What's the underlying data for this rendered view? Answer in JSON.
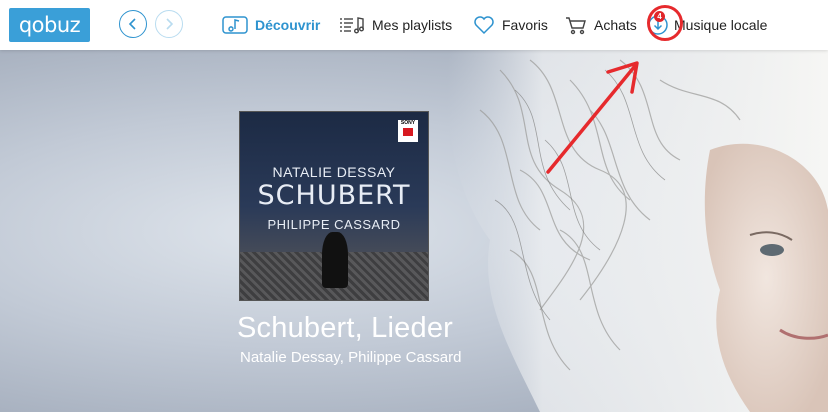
{
  "topbar": {
    "logo": "qobuz",
    "nav": {
      "back_icon": "chevron-left-icon",
      "forward_icon": "chevron-right-icon"
    },
    "menu": [
      {
        "label": "Découvrir",
        "icon": "music-note-icon",
        "active": true
      },
      {
        "label": "Mes playlists",
        "icon": "playlist-icon",
        "active": false
      },
      {
        "label": "Favoris",
        "icon": "heart-icon",
        "active": false
      },
      {
        "label": "Achats",
        "icon": "cart-icon",
        "active": false
      },
      {
        "label": "Musique locale",
        "icon": "download-icon",
        "active": false,
        "badge": "4"
      }
    ]
  },
  "hero": {
    "cover": {
      "label": "SONY",
      "artist_line1": "NATALIE DESSAY",
      "title": "SCHUBERT",
      "artist_line2": "PHILIPPE CASSARD"
    },
    "album_title": "Schubert, Lieder",
    "album_artist": "Natalie Dessay, Philippe Cassard"
  },
  "colors": {
    "brand": "#3a9fd8",
    "accent": "#2e93cf",
    "badge": "#e0262b",
    "annotation": "#e62a2d"
  }
}
